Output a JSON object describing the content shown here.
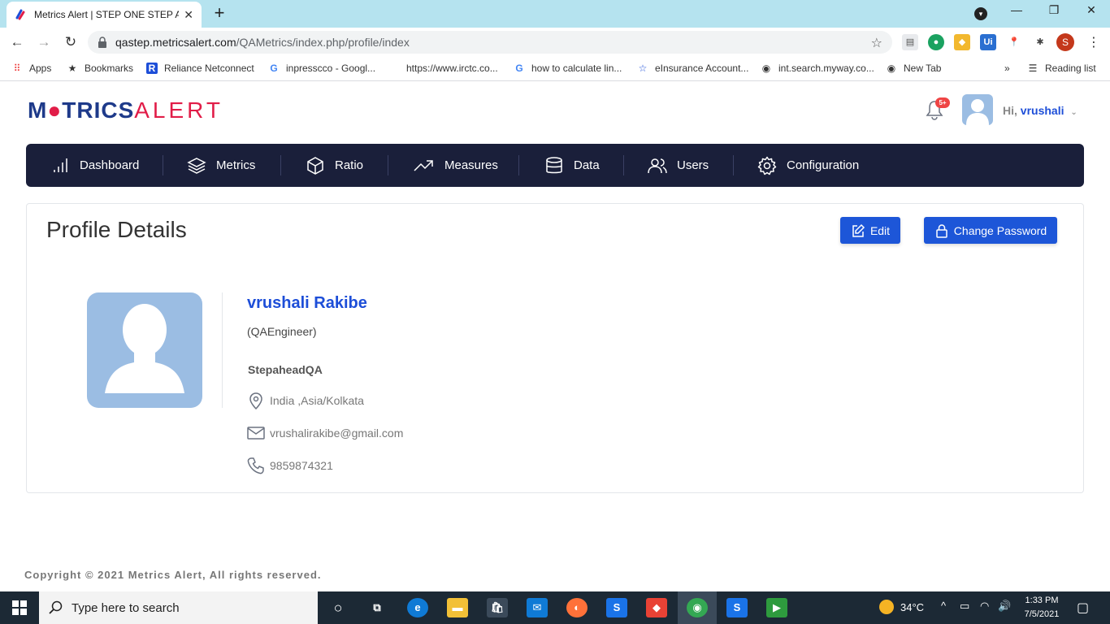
{
  "browser": {
    "tab_title": "Metrics Alert | STEP ONE STEP AH",
    "url_host": "qastep.metricsalert.com",
    "url_path": "/QAMetrics/index.php/profile/index",
    "profile_initial": "S",
    "bookmarks": [
      {
        "label": "Apps",
        "icon": "apps-grid-icon"
      },
      {
        "label": "Bookmarks",
        "icon": "star-icon"
      },
      {
        "label": "Reliance Netconnect",
        "icon": "reliance-icon"
      },
      {
        "label": "inpresscco - Googl...",
        "icon": "google-icon"
      },
      {
        "label": "https://www.irctc.co...",
        "icon": "blank-icon"
      },
      {
        "label": "how to calculate lin...",
        "icon": "google-icon"
      },
      {
        "label": "eInsurance Account...",
        "icon": "einsurance-icon"
      },
      {
        "label": "int.search.myway.co...",
        "icon": "globe-icon"
      },
      {
        "label": "New Tab",
        "icon": "globe-icon"
      }
    ],
    "overflow": "»",
    "reading_list": "Reading list"
  },
  "app": {
    "logo_text_1": "M",
    "logo_text_o": "●",
    "logo_text_2": "TRICS",
    "logo_text_3": "ALERT",
    "notification_badge": "5+",
    "greeting_hi": "Hi,",
    "username": "vrushali",
    "nav": [
      {
        "label": "Dashboard",
        "icon": "bar-chart-icon"
      },
      {
        "label": "Metrics",
        "icon": "layers-icon"
      },
      {
        "label": "Ratio",
        "icon": "cube-icon"
      },
      {
        "label": "Measures",
        "icon": "trending-up-icon"
      },
      {
        "label": "Data",
        "icon": "database-icon"
      },
      {
        "label": "Users",
        "icon": "users-icon"
      },
      {
        "label": "Configuration",
        "icon": "gear-icon"
      }
    ]
  },
  "profile": {
    "title": "Profile Details",
    "edit_label": "Edit",
    "change_password_label": "Change Password",
    "full_name": "vrushali Rakibe",
    "role": "(QAEngineer)",
    "company": "StepaheadQA",
    "location": "India ,Asia/Kolkata",
    "email": "vrushalirakibe@gmail.com",
    "phone": "9859874321"
  },
  "footer": {
    "copyright": "Copyright © 2021 Metrics Alert, All rights reserved."
  },
  "taskbar": {
    "search_placeholder": "Type here to search",
    "temperature": "34°C",
    "time": "1:33 PM",
    "date": "7/5/2021"
  }
}
